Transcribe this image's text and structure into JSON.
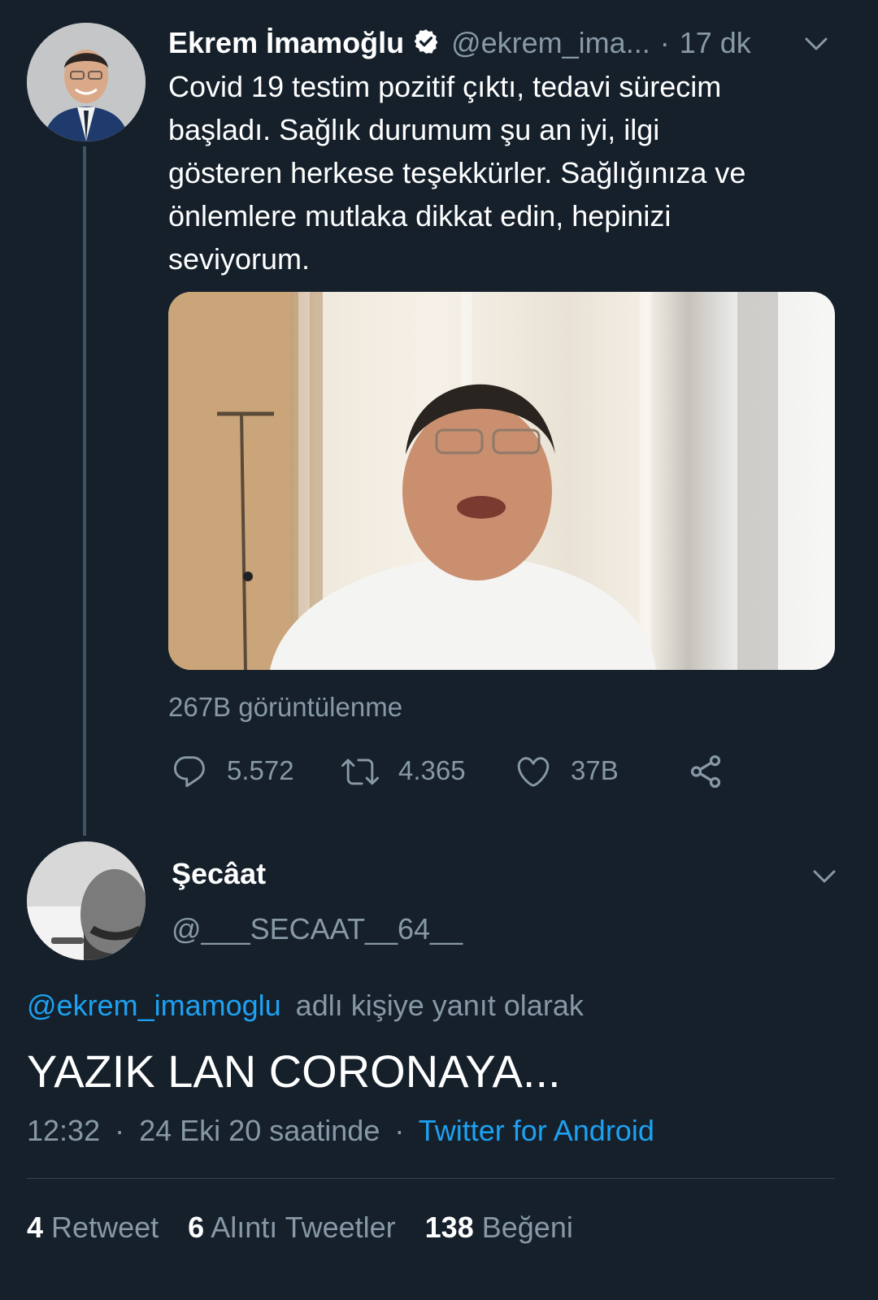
{
  "tweet": {
    "author_name": "Ekrem İmamoğlu",
    "handle": "@ekrem_ima...",
    "separator": "·",
    "time_ago": "17 dk",
    "text_lines": [
      "Covid 19 testim pozitif çıktı, tedavi sürecim",
      "başladı. Sağlık durumum şu an iyi, ilgi",
      "gösteren herkese teşekkürler. Sağlığınıza ve",
      "önlemlere mutlaka dikkat edin, hepinizi",
      "seviyorum."
    ],
    "views": "267B görüntülenme",
    "replies": "5.572",
    "retweets": "4.365",
    "likes": "37B"
  },
  "reply": {
    "author_name": "Şecâat",
    "handle": "@___SECAAT__64__",
    "replying_to_handle": "@ekrem_imamoglu",
    "replying_to_suffix": "adlı kişiye yanıt olarak",
    "text": "YAZIK LAN CORONAYA...",
    "time": "12:32",
    "date": "24 Eki 20 saatinde",
    "separator": "·",
    "source": "Twitter for Android",
    "retweet_count": "4",
    "retweet_label": "Retweet",
    "quote_count": "6",
    "quote_label": "Alıntı Tweetler",
    "like_count": "138",
    "like_label": "Beğeni"
  },
  "colors": {
    "background": "#15202b",
    "muted": "#8899a6",
    "link": "#1da1f2",
    "thread_line": "#3d5466"
  }
}
